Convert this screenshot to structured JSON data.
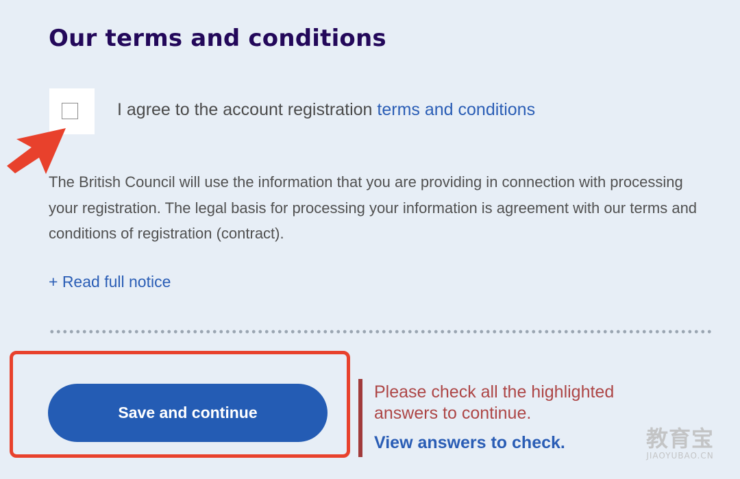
{
  "section": {
    "title": "Our terms and conditions"
  },
  "consent": {
    "label_prefix": "I agree to the account registration",
    "link_text": "terms and conditions",
    "checked": false
  },
  "legal_notice": {
    "text": "The British Council will use the information that you are providing in connection with processing your registration. The legal basis for processing your information is agreement with our terms and conditions of registration (contract).",
    "read_more_label": "+ Read full notice"
  },
  "form": {
    "save_label": "Save and continue"
  },
  "error": {
    "message": "Please check all the highlighted answers to continue.",
    "link_text": "View answers to check."
  },
  "annotations": {
    "arrow_color": "#e8412c",
    "highlight_color": "#e8412c"
  },
  "watermark": {
    "main": "教育宝",
    "sub": "JIAOYUBAO.CN"
  },
  "colors": {
    "background": "#e7eef6",
    "heading": "#23085a",
    "link": "#2a5db5",
    "button": "#245cb4",
    "error_text": "#ad4646",
    "error_bar": "#a13b3b"
  }
}
